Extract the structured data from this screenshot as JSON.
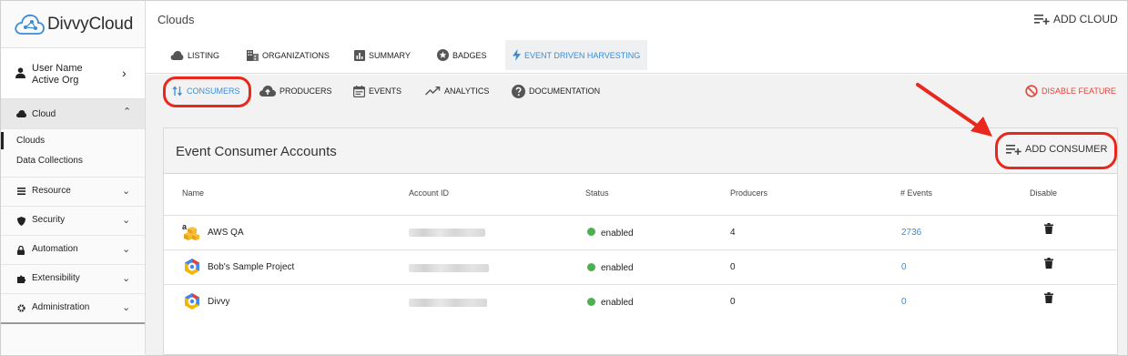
{
  "brand": {
    "name": "DivvyCloud"
  },
  "user": {
    "name": "User Name",
    "org": "Active Org"
  },
  "sidebar": {
    "cloud_label": "Cloud",
    "sub_items": [
      "Clouds",
      "Data Collections"
    ],
    "items": [
      {
        "label": "Resource",
        "icon": "list-icon"
      },
      {
        "label": "Security",
        "icon": "shield-icon"
      },
      {
        "label": "Automation",
        "icon": "lock-icon"
      },
      {
        "label": "Extensibility",
        "icon": "puzzle-icon"
      },
      {
        "label": "Administration",
        "icon": "gear-icon"
      }
    ]
  },
  "header": {
    "title": "Clouds",
    "add_cloud": "ADD CLOUD"
  },
  "tabs": [
    {
      "label": "LISTING",
      "icon": "cloud-icon"
    },
    {
      "label": "ORGANIZATIONS",
      "icon": "building-icon"
    },
    {
      "label": "SUMMARY",
      "icon": "bar-chart-icon"
    },
    {
      "label": "BADGES",
      "icon": "star-icon"
    },
    {
      "label": "EVENT DRIVEN HARVESTING",
      "icon": "bolt-icon",
      "active": true
    }
  ],
  "subtabs": [
    {
      "label": "CONSUMERS",
      "icon": "swap-icon",
      "active": true
    },
    {
      "label": "PRODUCERS",
      "icon": "cloud-upload-icon"
    },
    {
      "label": "EVENTS",
      "icon": "calendar-icon"
    },
    {
      "label": "ANALYTICS",
      "icon": "trend-icon"
    },
    {
      "label": "DOCUMENTATION",
      "icon": "help-icon"
    }
  ],
  "disable_feature": "DISABLE FEATURE",
  "panel": {
    "title": "Event Consumer Accounts",
    "add_consumer": "ADD CONSUMER",
    "columns": [
      "Name",
      "Account ID",
      "Status",
      "Producers",
      "# Events",
      "Disable"
    ],
    "rows": [
      {
        "name": "AWS QA",
        "provider": "aws",
        "status": "enabled",
        "producers": "4",
        "events": "2736"
      },
      {
        "name": "Bob's Sample Project",
        "provider": "gcp",
        "status": "enabled",
        "producers": "0",
        "events": "0"
      },
      {
        "name": "Divvy",
        "provider": "gcp",
        "status": "enabled",
        "producers": "0",
        "events": "0"
      }
    ]
  },
  "colors": {
    "accent": "#3a8dd8",
    "highlight": "#e9271d",
    "status_ok": "#4caf50",
    "danger": "#e0453c"
  }
}
